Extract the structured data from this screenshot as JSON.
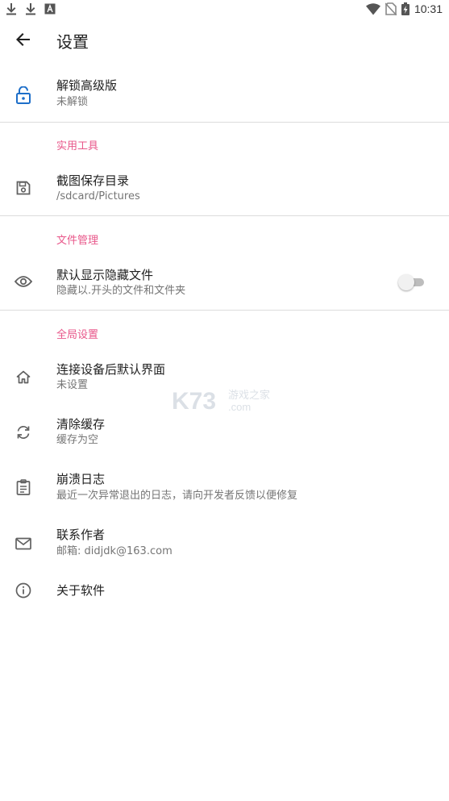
{
  "status_bar": {
    "time": "10:31",
    "left_icons": [
      "download-icon",
      "download-icon",
      "a-notification-icon"
    ],
    "right_icons": [
      "wifi-icon",
      "no-sim-icon",
      "battery-charging-icon"
    ]
  },
  "app_bar": {
    "title": "设置",
    "back_icon": "arrow-back-icon"
  },
  "unlock": {
    "icon": "lock-open-icon",
    "title": "解锁高级版",
    "subtitle": "未解锁",
    "icon_color": "#1e6fc9"
  },
  "sections": {
    "tools": {
      "header": "实用工具",
      "screenshot_dir": {
        "icon": "save-icon",
        "title": "截图保存目录",
        "subtitle": "/sdcard/Pictures"
      }
    },
    "files": {
      "header": "文件管理",
      "show_hidden": {
        "icon": "eye-icon",
        "title": "默认显示隐藏文件",
        "subtitle": "隐藏以.开头的文件和文件夹",
        "enabled": false
      }
    },
    "global": {
      "header": "全局设置",
      "items": [
        {
          "icon": "home-icon",
          "title": "连接设备后默认界面",
          "subtitle": "未设置"
        },
        {
          "icon": "sync-icon",
          "title": "清除缓存",
          "subtitle": "缓存为空"
        },
        {
          "icon": "clipboard-icon",
          "title": "崩溃日志",
          "subtitle": "最近一次异常退出的日志，请向开发者反馈以便修复"
        },
        {
          "icon": "mail-icon",
          "title": "联系作者",
          "subtitle": "邮箱: didjdk@163.com"
        },
        {
          "icon": "info-icon",
          "title": "关于软件",
          "subtitle": ""
        }
      ]
    }
  },
  "watermark": {
    "brand": "K73",
    "tagline": "游戏之家",
    "domain": ".com"
  },
  "colors": {
    "accent": "#e8578a",
    "icon": "#616161",
    "divider": "#dcdcdc"
  }
}
